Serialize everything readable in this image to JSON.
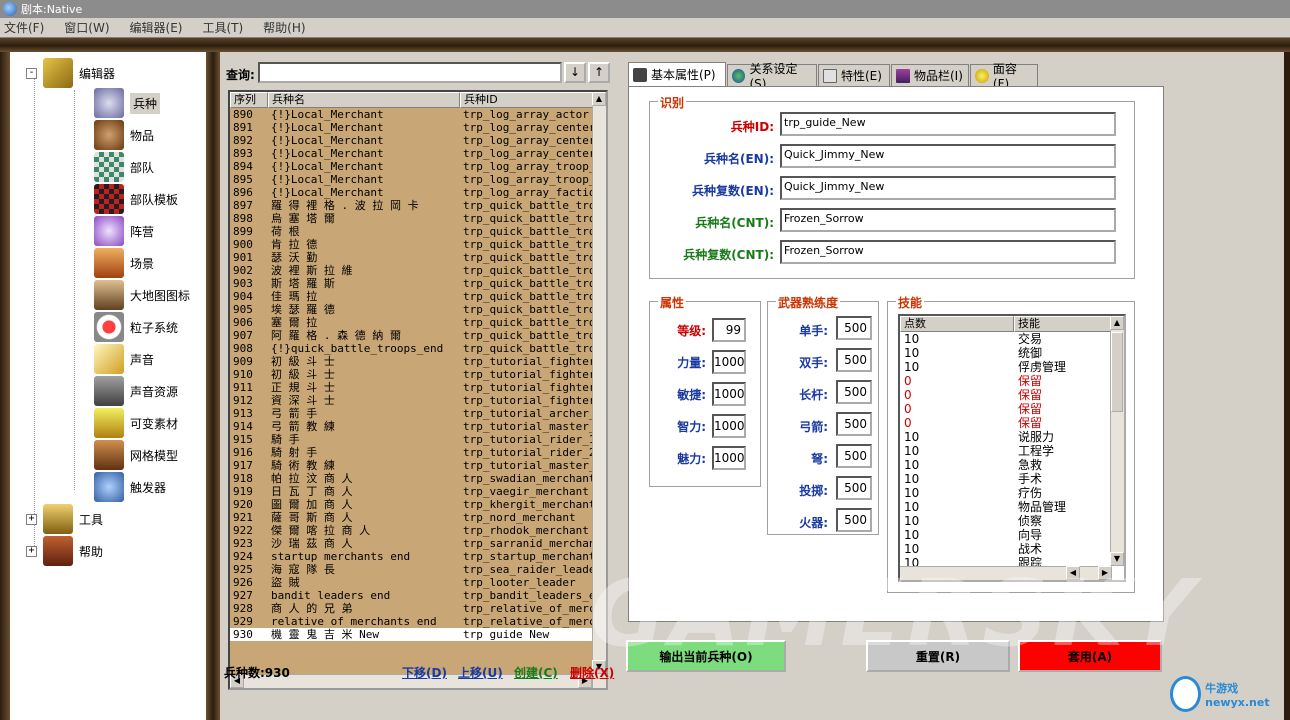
{
  "window": {
    "title": "剧本:Native"
  },
  "menu": [
    "文件(F)",
    "窗口(W)",
    "编辑器(E)",
    "工具(T)",
    "帮助(H)"
  ],
  "tree": {
    "root": "编辑器",
    "children": [
      "兵种",
      "物品",
      "部队",
      "部队模板",
      "阵营",
      "场景",
      "大地图图标",
      "粒子系统",
      "声音",
      "声音资源",
      "可变素材",
      "网格模型",
      "触发器"
    ],
    "tools": "工具",
    "help": "帮助",
    "expand_symbol": "-",
    "collapse_symbol": "+"
  },
  "search": {
    "label": "查询:",
    "value": "",
    "down": "↓",
    "up": "↑"
  },
  "troop_list": {
    "headers": [
      "序列",
      "兵种名",
      "兵种ID"
    ],
    "rows": [
      [
        "890",
        "{!}Local_Merchant",
        "trp_log_array_actor"
      ],
      [
        "891",
        "{!}Local_Merchant",
        "trp_log_array_center_o"
      ],
      [
        "892",
        "{!}Local_Merchant",
        "trp_log_array_center_o"
      ],
      [
        "893",
        "{!}Local_Merchant",
        "trp_log_array_center_o"
      ],
      [
        "894",
        "{!}Local_Merchant",
        "trp_log_array_troop_ob"
      ],
      [
        "895",
        "{!}Local_Merchant",
        "trp_log_array_troop_ob"
      ],
      [
        "896",
        "{!}Local_Merchant",
        "trp_log_array_faction_"
      ],
      [
        "897",
        "羅 得 裡 格 . 波 拉 岡 卡",
        "trp_quick_battle_troop"
      ],
      [
        "898",
        "烏 塞 塔 爾",
        "trp_quick_battle_troop"
      ],
      [
        "899",
        "荷 根",
        "trp_quick_battle_troop"
      ],
      [
        "900",
        "肯 拉 德",
        "trp_quick_battle_troop"
      ],
      [
        "901",
        "瑟 沃 勤",
        "trp_quick_battle_troop"
      ],
      [
        "902",
        "波 裡 斯 拉 維",
        "trp_quick_battle_troop"
      ],
      [
        "903",
        "斯 塔 羅 斯",
        "trp_quick_battle_troop"
      ],
      [
        "904",
        "佳 瑪 拉",
        "trp_quick_battle_troop"
      ],
      [
        "905",
        "埃 瑟 羅 德",
        "trp_quick_battle_troop"
      ],
      [
        "906",
        "塞 爾 拉",
        "trp_quick_battle_troop"
      ],
      [
        "907",
        "阿 羅 格 . 森 德 納 爾",
        "trp_quick_battle_troop"
      ],
      [
        "908",
        "{!}quick_battle_troops_end",
        "trp_quick_battle_troop"
      ],
      [
        "909",
        "初 級 斗 士",
        "trp_tutorial_fighter_1"
      ],
      [
        "910",
        "初 級 斗 士",
        "trp_tutorial_fighter_2"
      ],
      [
        "911",
        "正 規 斗 士",
        "trp_tutorial_fighter_3"
      ],
      [
        "912",
        "資 深 斗 士",
        "trp_tutorial_fighter_4"
      ],
      [
        "913",
        "弓 箭 手",
        "trp_tutorial_archer_1"
      ],
      [
        "914",
        "弓 箭 教 練",
        "trp_tutorial_master_ar"
      ],
      [
        "915",
        "騎 手",
        "trp_tutorial_rider_1"
      ],
      [
        "916",
        "騎 射 手",
        "trp_tutorial_rider_2"
      ],
      [
        "917",
        "騎 術 教 練",
        "trp_tutorial_master_ho"
      ],
      [
        "918",
        "帕 拉 汶 商 人",
        "trp_swadian_merchant"
      ],
      [
        "919",
        "日 瓦 丁 商 人",
        "trp_vaegir_merchant"
      ],
      [
        "920",
        "圖 爾 加 商 人",
        "trp_khergit_merchant"
      ],
      [
        "921",
        "薩 哥 斯 商 人",
        "trp_nord_merchant"
      ],
      [
        "922",
        "傑 爾 喀 拉 商 人",
        "trp_rhodok_merchant"
      ],
      [
        "923",
        "沙 瑞 茲 商 人",
        "trp_sarranid_merchant"
      ],
      [
        "924",
        "startup merchants end",
        "trp_startup_merchants_"
      ],
      [
        "925",
        "海 寇 隊 長",
        "trp_sea_raider_leader"
      ],
      [
        "926",
        "盜 賊",
        "trp_looter_leader"
      ],
      [
        "927",
        "bandit leaders end",
        "trp_bandit_leaders_end"
      ],
      [
        "928",
        "商 人 的 兄 弟",
        "trp_relative_of_mercha"
      ],
      [
        "929",
        "relative of merchants end",
        "trp_relative_of_mercha"
      ],
      [
        "930",
        "機 靈 鬼 吉 米 New",
        "trp guide New"
      ]
    ],
    "count_label": "兵种数:930",
    "actions": [
      "下移(D)",
      "上移(U)",
      "创建(C)",
      "删除(X)"
    ]
  },
  "tabs": [
    "基本属性(P)",
    "关系设定(S)",
    "特性(E)",
    "物品栏(I)",
    "面容(F)"
  ],
  "identity": {
    "title": "识别",
    "fields": [
      {
        "label": "兵种ID:",
        "value": "trp_guide_New"
      },
      {
        "label": "兵种名(EN):",
        "value": "Quick_Jimmy_New"
      },
      {
        "label": "兵种复数(EN):",
        "value": "Quick_Jimmy_New"
      },
      {
        "label": "兵种名(CNT):",
        "value": "Frozen_Sorrow"
      },
      {
        "label": "兵种复数(CNT):",
        "value": "Frozen_Sorrow"
      }
    ]
  },
  "attributes": {
    "title": "属性",
    "fields": [
      {
        "label": "等级:",
        "value": "99"
      },
      {
        "label": "力量:",
        "value": "1000"
      },
      {
        "label": "敏捷:",
        "value": "1000"
      },
      {
        "label": "智力:",
        "value": "1000"
      },
      {
        "label": "魅力:",
        "value": "1000"
      }
    ]
  },
  "proficiency": {
    "title": "武器熟练度",
    "fields": [
      {
        "label": "单手:",
        "value": "500"
      },
      {
        "label": "双手:",
        "value": "500"
      },
      {
        "label": "长杆:",
        "value": "500"
      },
      {
        "label": "弓箭:",
        "value": "500"
      },
      {
        "label": "弩:",
        "value": "500"
      },
      {
        "label": "投掷:",
        "value": "500"
      },
      {
        "label": "火器:",
        "value": "500"
      }
    ]
  },
  "skills": {
    "title": "技能",
    "headers": [
      "点数",
      "技能"
    ],
    "rows": [
      [
        "10",
        "交易"
      ],
      [
        "10",
        "统御"
      ],
      [
        "10",
        "俘虏管理"
      ],
      [
        "0",
        "保留"
      ],
      [
        "0",
        "保留"
      ],
      [
        "0",
        "保留"
      ],
      [
        "0",
        "保留"
      ],
      [
        "10",
        "说服力"
      ],
      [
        "10",
        "工程学"
      ],
      [
        "10",
        "急救"
      ],
      [
        "10",
        "手术"
      ],
      [
        "10",
        "疗伤"
      ],
      [
        "10",
        "物品管理"
      ],
      [
        "10",
        "侦察"
      ],
      [
        "10",
        "向导"
      ],
      [
        "10",
        "战术"
      ],
      [
        "10",
        "跟踪"
      ]
    ]
  },
  "buttons": {
    "export": "输出当前兵种(O)",
    "reset": "重置(R)",
    "apply": "套用(A)"
  },
  "watermark": {
    "text": "GAMERSKY",
    "logo_text": "牛游戏 newyx.net"
  },
  "colors": {
    "list_bg": "#c8a676",
    "group_title": "#cc3300",
    "export_btn": "#7ddc7d",
    "apply_btn": "#ff0000",
    "reserved_text": "#cc0000"
  }
}
